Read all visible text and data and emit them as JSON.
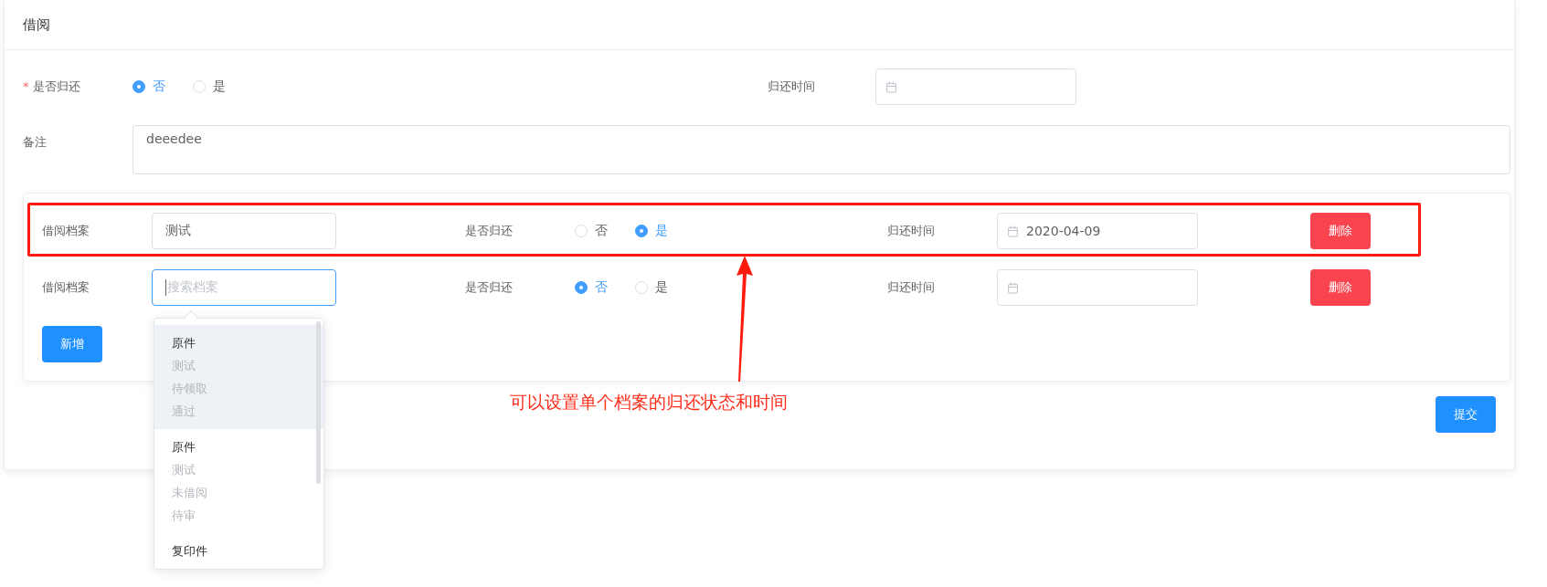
{
  "card": {
    "title": "借阅"
  },
  "form": {
    "returned": {
      "label": "是否归还",
      "required_mark": "*",
      "options": [
        {
          "label": "否",
          "selected": true
        },
        {
          "label": "是",
          "selected": false
        }
      ]
    },
    "return_time": {
      "label": "归还时间"
    },
    "remark": {
      "label": "备注",
      "value": "deeedee"
    }
  },
  "items": [
    {
      "archive_label": "借阅档案",
      "archive_value": "测试",
      "focused": false,
      "returned_label": "是否归还",
      "options": [
        {
          "label": "否",
          "selected": false
        },
        {
          "label": "是",
          "selected": true
        }
      ],
      "time_label": "归还时间",
      "time_value": "2020-04-09",
      "delete": "删除"
    },
    {
      "archive_label": "借阅档案",
      "archive_placeholder": "搜索档案",
      "focused": true,
      "returned_label": "是否归还",
      "options": [
        {
          "label": "否",
          "selected": true
        },
        {
          "label": "是",
          "selected": false
        }
      ],
      "time_label": "归还时间",
      "delete": "删除"
    }
  ],
  "dropdown": {
    "options": [
      {
        "title": "原件",
        "lines": [
          "测试",
          "待领取",
          "通过"
        ],
        "selected": true
      },
      {
        "title": "原件",
        "lines": [
          "测试",
          "未借阅",
          "待审"
        ],
        "selected": false
      },
      {
        "title": "复印件",
        "selected": false
      }
    ]
  },
  "add_button": "新增",
  "submit_button": "提交",
  "annotation": {
    "text": "可以设置单个档案的归还状态和时间"
  }
}
